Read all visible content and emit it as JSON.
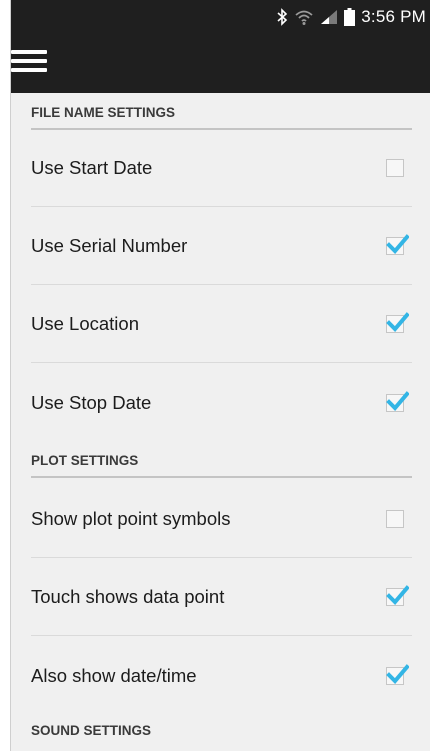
{
  "status_bar": {
    "time": "3:56 PM",
    "icons": [
      "bluetooth-icon",
      "wifi-icon",
      "signal-icon",
      "battery-icon"
    ]
  },
  "action_bar": {
    "menu_icon": "hamburger-menu-icon"
  },
  "colors": {
    "bar_background": "#1f1f1f",
    "content_background": "#f0f0f0",
    "check_accent": "#33b5e5"
  },
  "sections": [
    {
      "title": "FILE NAME SETTINGS",
      "items": [
        {
          "label": "Use Start Date",
          "checked": false
        },
        {
          "label": "Use Serial Number",
          "checked": true
        },
        {
          "label": "Use Location",
          "checked": true
        },
        {
          "label": "Use Stop Date",
          "checked": true
        }
      ]
    },
    {
      "title": "PLOT SETTINGS",
      "items": [
        {
          "label": "Show plot point symbols",
          "checked": false
        },
        {
          "label": "Touch shows data point",
          "checked": true
        },
        {
          "label": "Also show date/time",
          "checked": true
        }
      ]
    },
    {
      "title": "SOUND SETTINGS",
      "items": []
    }
  ]
}
